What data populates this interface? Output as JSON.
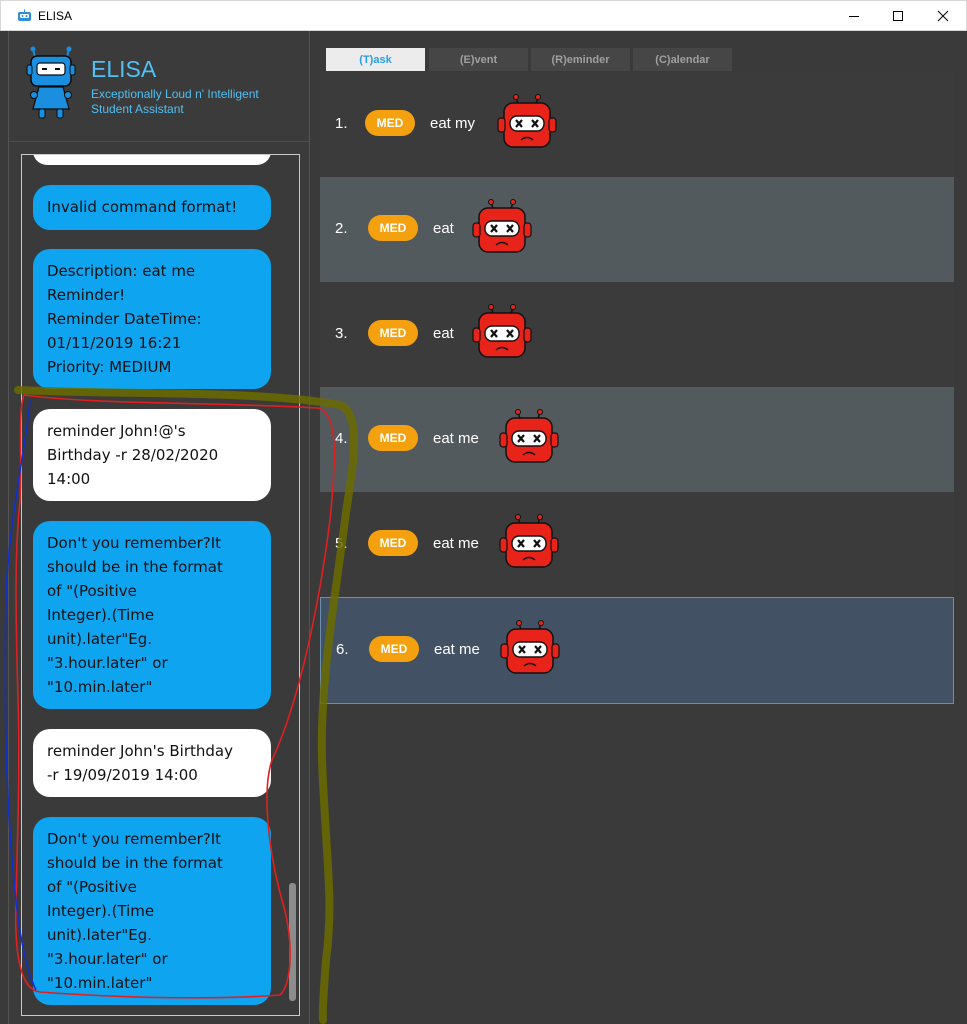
{
  "window": {
    "title": "ELISA",
    "controls": [
      "minimize-icon",
      "maximize-icon",
      "close-icon"
    ]
  },
  "header": {
    "brand": "ELISA",
    "tagline_line1": "Exceptionally Loud n' Intelligent",
    "tagline_line2": "Student Assistant"
  },
  "chat": {
    "messages": [
      {
        "from": "bot",
        "lines": [
          "Invalid command format!"
        ]
      },
      {
        "from": "bot",
        "lines": [
          "Description: eat me",
          "Reminder!",
          "Reminder DateTime:",
          "01/11/2019 16:21",
          "Priority: MEDIUM"
        ]
      },
      {
        "from": "user",
        "lines": [
          "reminder John!@'s",
          "Birthday -r 28/02/2020",
          "14:00"
        ]
      },
      {
        "from": "bot",
        "lines": [
          "Don't you remember?It",
          "should be in the format",
          "of \"(Positive",
          "Integer).(Time",
          "unit).later\"Eg.",
          "\"3.hour.later\" or",
          "\"10.min.later\""
        ]
      },
      {
        "from": "user",
        "lines": [
          "reminder John's Birthday",
          "-r 19/09/2019 14:00"
        ]
      },
      {
        "from": "bot",
        "lines": [
          "Don't you remember?It",
          "should be in the format",
          "of \"(Positive",
          "Integer).(Time",
          "unit).later\"Eg.",
          "\"3.hour.later\" or",
          "\"10.min.later\""
        ]
      }
    ]
  },
  "tabs": [
    {
      "label": "(T)ask",
      "active": true
    },
    {
      "label": "(E)vent",
      "active": false
    },
    {
      "label": "(R)eminder",
      "active": false
    },
    {
      "label": "(C)alendar",
      "active": false
    }
  ],
  "tasks": [
    {
      "index": "1.",
      "priority": "MED",
      "description": "eat my",
      "status_icon": "sad-robot-icon"
    },
    {
      "index": "2.",
      "priority": "MED",
      "description": "eat",
      "status_icon": "sad-robot-icon"
    },
    {
      "index": "3.",
      "priority": "MED",
      "description": "eat",
      "status_icon": "sad-robot-icon"
    },
    {
      "index": "4.",
      "priority": "MED",
      "description": "eat me",
      "status_icon": "sad-robot-icon"
    },
    {
      "index": "5.",
      "priority": "MED",
      "description": "eat me",
      "status_icon": "sad-robot-icon"
    },
    {
      "index": "6.",
      "priority": "MED",
      "description": "eat me",
      "status_icon": "sad-robot-icon"
    }
  ],
  "colors": {
    "accent": "#4ec1f5",
    "bot_bubble": "#0ea4ef",
    "user_bubble": "#ffffff",
    "priority_badge": "#f5a10f",
    "robot_red": "#e8231a",
    "annotation_red": "#e02020",
    "annotation_blue": "#1030d0",
    "annotation_olive": "#6b6b00"
  }
}
